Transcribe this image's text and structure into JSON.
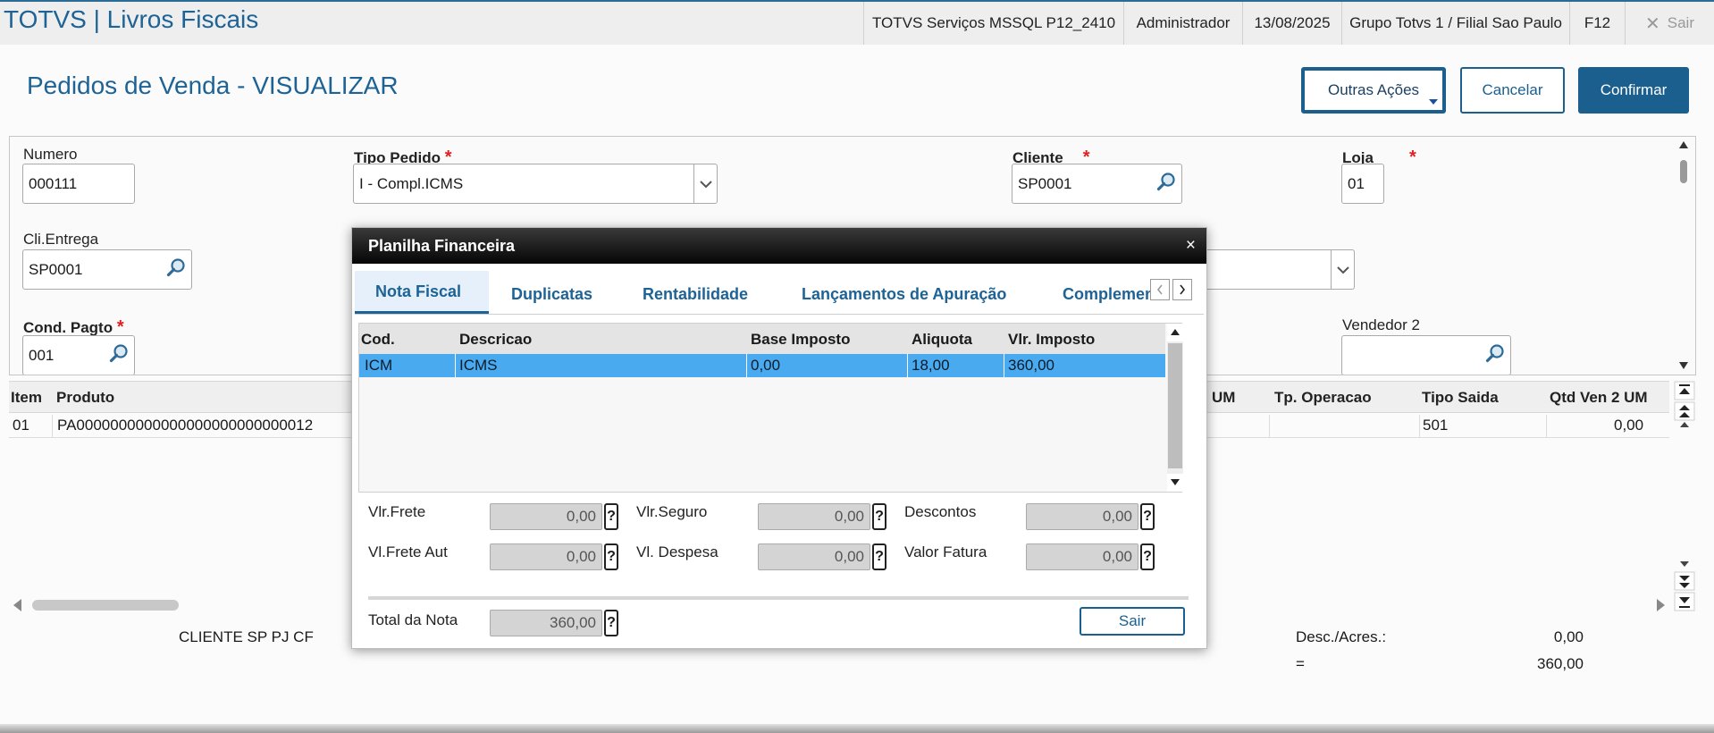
{
  "topbar": {
    "app_title": "TOTVS | Livros Fiscais",
    "environment": "TOTVS Serviços MSSQL P12_2410",
    "user": "Administrador",
    "date": "13/08/2025",
    "branch": "Grupo Totvs 1 / Filial Sao Paulo",
    "shortcut": "F12",
    "exit_label": "Sair"
  },
  "header": {
    "title": "Pedidos de Venda - VISUALIZAR",
    "other_actions": "Outras Ações",
    "cancel": "Cancelar",
    "confirm": "Confirmar"
  },
  "form": {
    "numero": {
      "label": "Numero",
      "value": "000111"
    },
    "tipo_pedido": {
      "label": "Tipo Pedido",
      "value": "I - Compl.ICMS"
    },
    "cliente": {
      "label": "Cliente",
      "value": "SP0001"
    },
    "loja": {
      "label": "Loja",
      "value": "01"
    },
    "cli_entrega": {
      "label": "Cli.Entrega",
      "value": "SP0001"
    },
    "cond_pagto": {
      "label": "Cond. Pagto",
      "value": "001"
    },
    "vendedor2": {
      "label": "Vendedor 2",
      "value": ""
    },
    "required_mark": "*"
  },
  "grid": {
    "columns": [
      "Item",
      "Produto",
      "UM",
      "Tp. Operacao",
      "Tipo Saida",
      "Qtd Ven 2 UM"
    ],
    "rows": [
      {
        "item": "01",
        "produto": "PA0000000000000000000000000012",
        "tipo_saida": "501",
        "qtd": "0,00"
      }
    ]
  },
  "footer": {
    "client_name": "CLIENTE SP PJ CF",
    "desc_label": "Desc./Acres.:",
    "desc_value": "0,00",
    "total_label": "=",
    "total_value": "360,00"
  },
  "modal": {
    "title": "Planilha Financeira",
    "close": "×",
    "tabs": [
      "Nota Fiscal",
      "Duplicatas",
      "Rentabilidade",
      "Lançamentos de Apuração",
      "Complemento"
    ],
    "columns": [
      "Cod.",
      "Descricao",
      "Base Imposto",
      "Aliquota",
      "Vlr. Imposto"
    ],
    "row": {
      "cod": "ICM",
      "descricao": "ICMS",
      "base": "0,00",
      "aliquota": "18,00",
      "imposto": "360,00"
    },
    "fields": {
      "vlr_frete": {
        "label": "Vlr.Frete",
        "value": "0,00"
      },
      "vlr_seguro": {
        "label": "Vlr.Seguro",
        "value": "0,00"
      },
      "descontos": {
        "label": "Descontos",
        "value": "0,00"
      },
      "vl_frete_aut": {
        "label": "Vl.Frete Aut",
        "value": "0,00"
      },
      "vl_despesa": {
        "label": "Vl. Despesa",
        "value": "0,00"
      },
      "valor_fatura": {
        "label": "Valor Fatura",
        "value": "0,00"
      },
      "total_nota": {
        "label": "Total da Nota",
        "value": "360,00"
      }
    },
    "help": "?",
    "exit_button": "Sair"
  },
  "colors": {
    "brand": "#1d6396",
    "selected_row": "#4aaaf0",
    "required": "#e02020"
  }
}
